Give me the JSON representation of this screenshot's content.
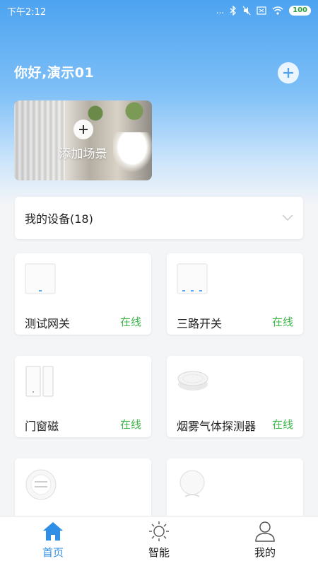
{
  "status_bar": {
    "time": "下午2:12",
    "signal_dots": "...",
    "battery": "100"
  },
  "header": {
    "greeting": "你好,演示01",
    "add_icon": "plus-circle-icon"
  },
  "scene": {
    "label": "添加场景",
    "icon": "plus-icon"
  },
  "devices": {
    "title": "我的设备(18)",
    "items": [
      {
        "name": "测试网关",
        "status": "在线",
        "icon": "gateway-icon"
      },
      {
        "name": "三路开关",
        "status": "在线",
        "icon": "three-way-switch-icon"
      },
      {
        "name": "门窗磁",
        "status": "在线",
        "icon": "door-sensor-icon"
      },
      {
        "name": "烟雾气体探测器",
        "status": "在线",
        "icon": "smoke-detector-icon"
      },
      {
        "name": "",
        "status": "",
        "icon": "thermostat-icon"
      },
      {
        "name": "",
        "status": "",
        "icon": "motion-sensor-icon"
      }
    ]
  },
  "tabs": [
    {
      "label": "首页",
      "icon": "home-icon",
      "active": true
    },
    {
      "label": "智能",
      "icon": "sun-icon",
      "active": false
    },
    {
      "label": "我的",
      "icon": "person-icon",
      "active": false
    }
  ],
  "colors": {
    "primary": "#2f8ee6",
    "online": "#3fb64a",
    "hero_top": "#4da3f0"
  }
}
